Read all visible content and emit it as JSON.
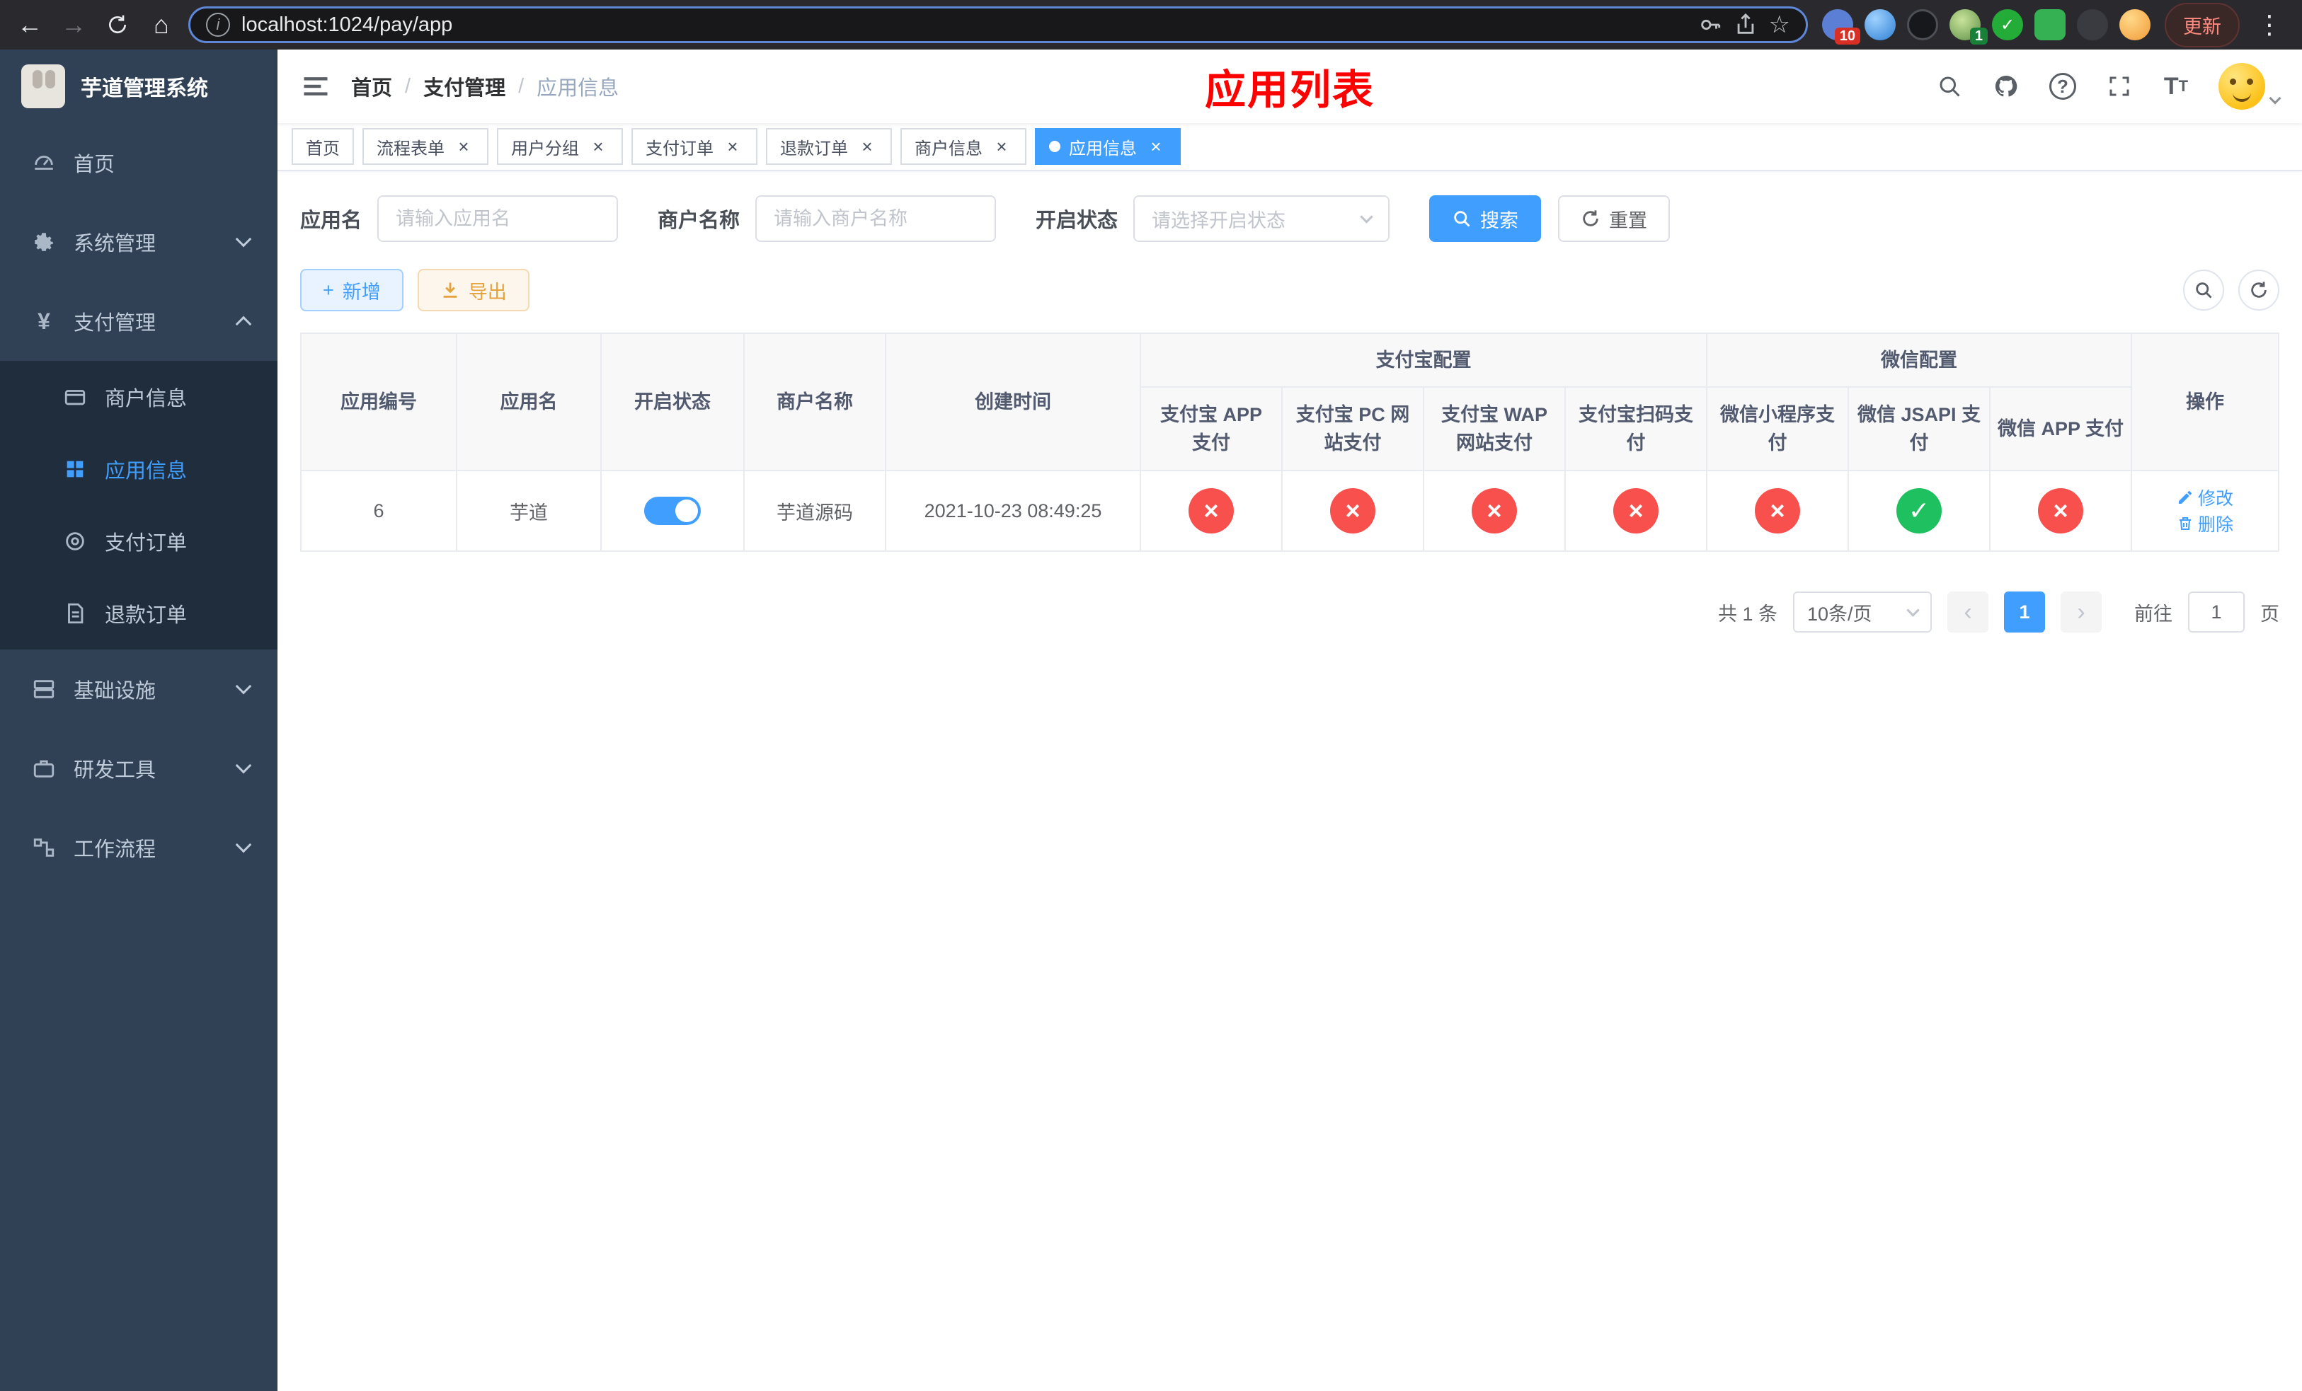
{
  "browser": {
    "url": "localhost:1024/pay/app",
    "update_label": "更新",
    "extension_badge": "10",
    "extension_badge_2": "1"
  },
  "icons": {
    "back": "←",
    "forward": "→",
    "home": "⌂",
    "info": "i",
    "star": "☆",
    "menu_dots": "⋮",
    "close": "×",
    "plus": "+",
    "check": "✓",
    "cross": "×",
    "prev": "‹",
    "next": "›",
    "yen": "¥",
    "question": "?"
  },
  "sidebar": {
    "logo_title": "芋道管理系统",
    "menu": [
      {
        "label": "首页"
      },
      {
        "label": "系统管理"
      },
      {
        "label": "支付管理"
      },
      {
        "label": "基础设施"
      },
      {
        "label": "研发工具"
      },
      {
        "label": "工作流程"
      }
    ],
    "submenu": [
      {
        "label": "商户信息"
      },
      {
        "label": "应用信息"
      },
      {
        "label": "支付订单"
      },
      {
        "label": "退款订单"
      }
    ]
  },
  "header": {
    "breadcrumb": [
      "首页",
      "支付管理",
      "应用信息"
    ],
    "separator": "/",
    "title": "应用列表"
  },
  "tabs": [
    {
      "label": "首页"
    },
    {
      "label": "流程表单"
    },
    {
      "label": "用户分组"
    },
    {
      "label": "支付订单"
    },
    {
      "label": "退款订单"
    },
    {
      "label": "商户信息"
    },
    {
      "label": "应用信息"
    }
  ],
  "filters": {
    "app_name_label": "应用名",
    "app_name_placeholder": "请输入应用名",
    "merchant_label": "商户名称",
    "merchant_placeholder": "请输入商户名称",
    "status_label": "开启状态",
    "status_placeholder": "请选择开启状态",
    "search_label": "搜索",
    "reset_label": "重置"
  },
  "toolbar": {
    "add_label": "新增",
    "export_label": "导出"
  },
  "table": {
    "columns": [
      "应用编号",
      "应用名",
      "开启状态",
      "商户名称",
      "创建时间"
    ],
    "group_alipay": "支付宝配置",
    "group_wechat": "微信配置",
    "alipay_cols": [
      "支付宝 APP 支付",
      "支付宝 PC 网站支付",
      "支付宝 WAP 网站支付",
      "支付宝扫码支付"
    ],
    "wechat_cols": [
      "微信小程序支付",
      "微信 JSAPI 支付",
      "微信 APP 支付"
    ],
    "col_ops": "操作",
    "row": {
      "id": "6",
      "name": "芋道",
      "enabled": true,
      "merchant": "芋道源码",
      "created": "2021-10-23 08:49:25",
      "configs": [
        false,
        false,
        false,
        false,
        false,
        true,
        false
      ],
      "edit": "修改",
      "delete": "删除"
    }
  },
  "pagination": {
    "total": "共 1 条",
    "page_size": "10条/页",
    "page": "1",
    "goto": "前往",
    "goto_value": "1",
    "unit": "页"
  },
  "colors": {
    "accent": "#409eff",
    "danger": "#f8504c",
    "success": "#1ec05f",
    "title_red": "#ff0000",
    "sidebar_bg": "#304156",
    "submenu_bg": "#1f2d3d"
  }
}
